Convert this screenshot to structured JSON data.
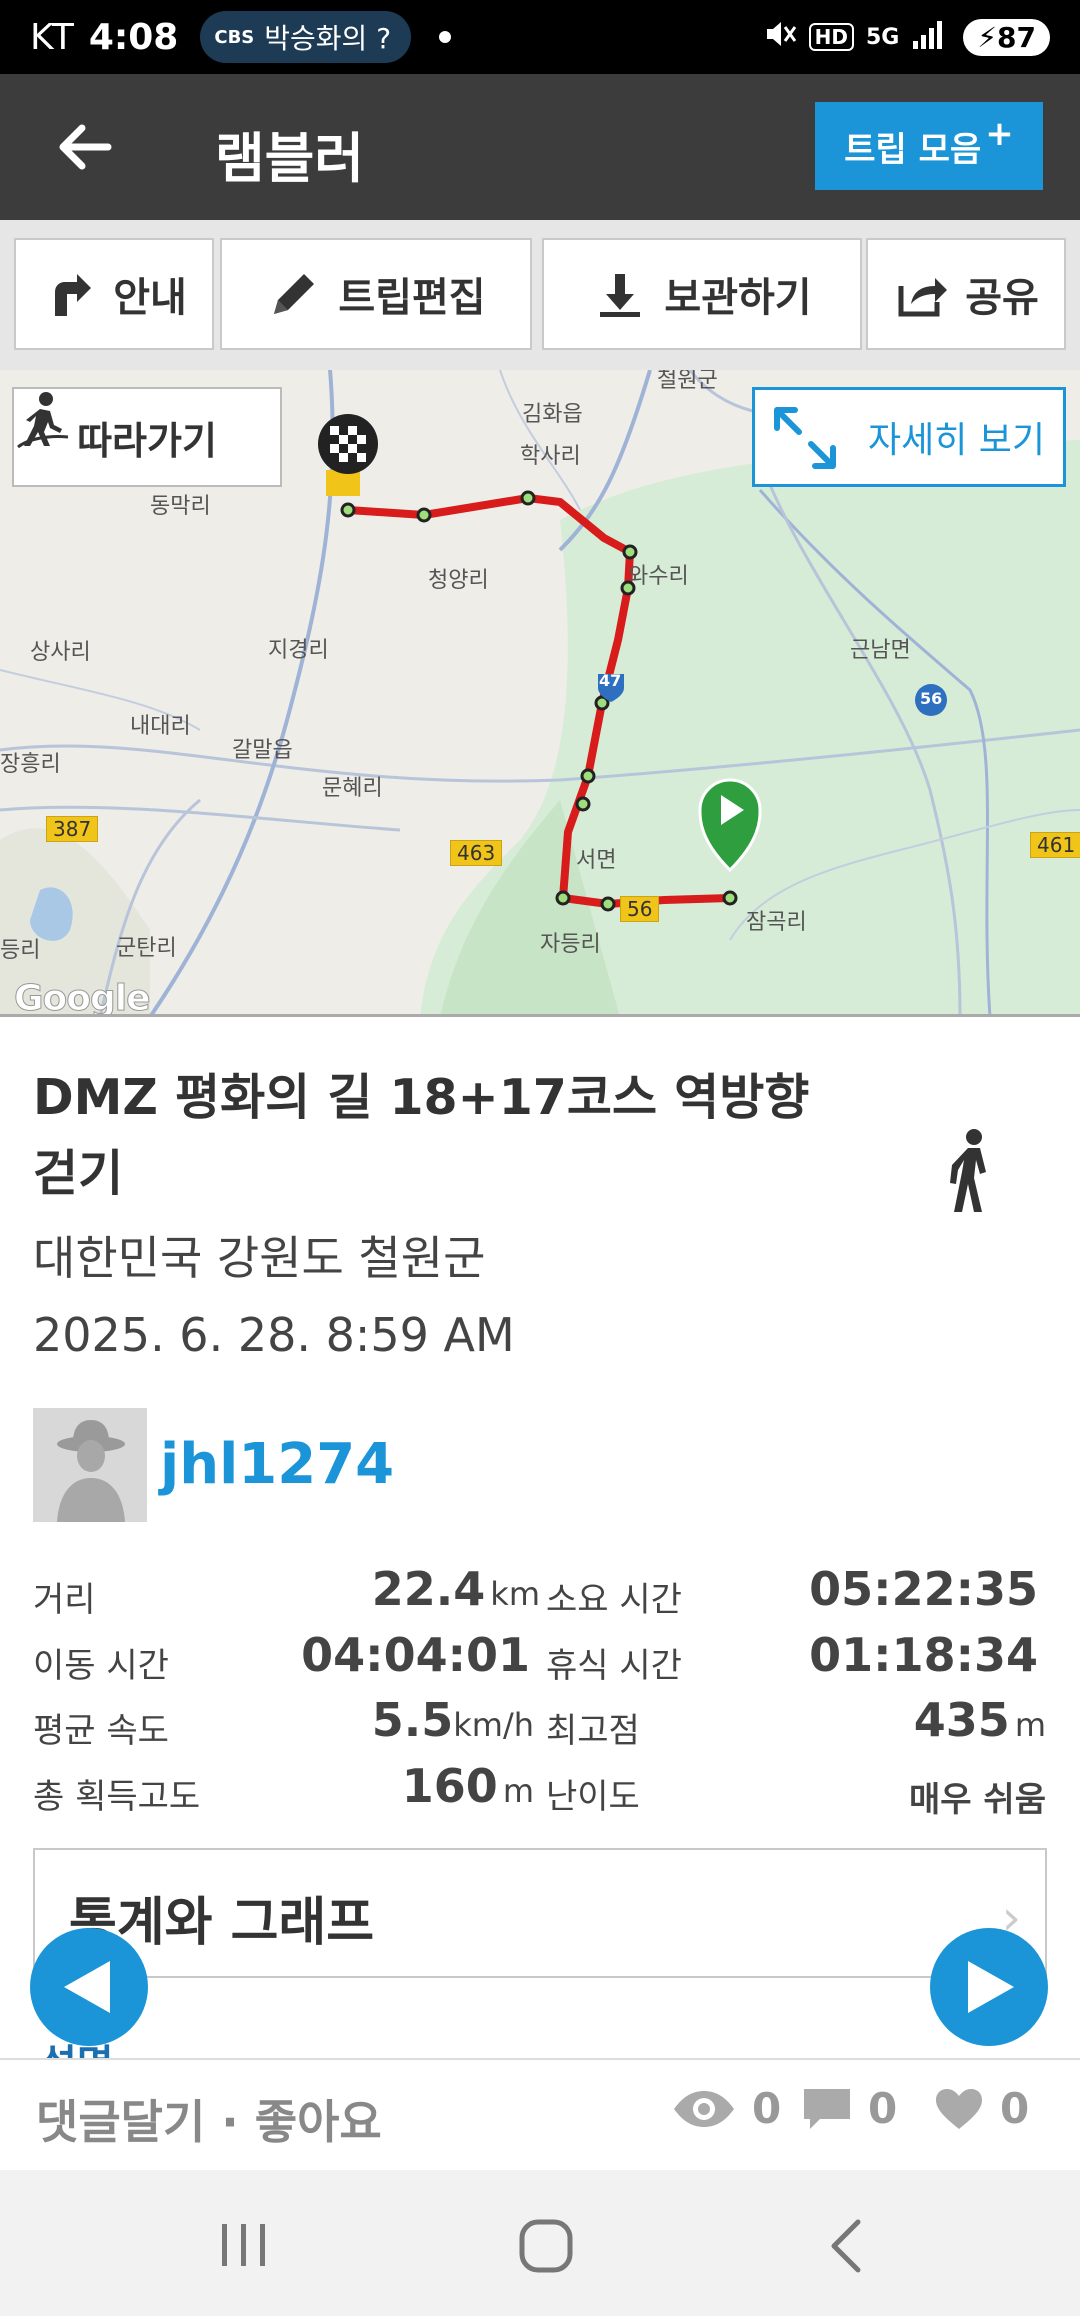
{
  "status_bar": {
    "carrier": "KT",
    "time": "4:08",
    "media_pill_logo": "CBS",
    "media_pill_text": "박승화의 ?",
    "network_hd": "HD",
    "network_5g": "5G",
    "battery": "87"
  },
  "app_bar": {
    "title": "램블러",
    "trip_collection_label": "트립 모음",
    "trip_collection_plus": "+"
  },
  "toolbar": {
    "guide_label": "안내",
    "edit_label": "트립편집",
    "save_label": "보관하기",
    "share_label": "공유"
  },
  "map": {
    "follow_label": "따라가기",
    "detail_label": "자세히 보기",
    "google_label": "Google",
    "labels": {
      "cheorwon": "철원군",
      "gimhwa": "김화읍",
      "haksari": "학사리",
      "dongmakri": "동막리",
      "cheongyangri": "청양리",
      "wasuri": "와수리",
      "sangsari": "상사리",
      "jigyeongri": "지경리",
      "geunnam": "근남면",
      "naedaeri": "내대리",
      "galmal": "갈말읍",
      "janghungri": "장흥리",
      "munhyeri": "문혜리",
      "seomyeon": "서면",
      "jamgokri": "잠곡리",
      "jadeungri": "자등리",
      "deungri": "등리",
      "guntanri": "군탄리",
      "route_387": "387",
      "route_463": "463",
      "route_56": "56",
      "route_56b": "56",
      "route_47": "47",
      "route_461": "461"
    }
  },
  "trip": {
    "title": "DMZ 평화의 길 18+17코스 역방향 걷기",
    "location": "대한민국 강원도 철원군",
    "date": "2025. 6. 28. 8:59 AM",
    "username": "jhl1274"
  },
  "stats": {
    "distance_label": "거리",
    "distance_value": "22.4",
    "distance_unit": "km",
    "duration_label": "소요 시간",
    "duration_value": "05:22:35",
    "moving_label": "이동 시간",
    "moving_value": "04:04:01",
    "rest_label": "휴식 시간",
    "rest_value": "01:18:34",
    "speed_label": "평균 속도",
    "speed_value": "5.5",
    "speed_unit": "km/h",
    "max_alt_label": "최고점",
    "max_alt_value": "435",
    "max_alt_unit": "m",
    "gain_label": "총 획득고도",
    "gain_value": "160",
    "gain_unit": "m",
    "difficulty_label": "난이도",
    "difficulty_value": "매우 쉬움"
  },
  "stats_graph_label": "통계와 그래프",
  "stats_graph_chevron": "›",
  "cut_text": "설명",
  "actions": {
    "comment_like_label": "댓글달기 · 좋아요",
    "views": "0",
    "comments": "0",
    "likes": "0"
  },
  "colors": {
    "accent": "#1b95d8",
    "app_bar": "#3c3c3c",
    "route": "#d81b1b",
    "start_marker": "#2e9e3e"
  }
}
